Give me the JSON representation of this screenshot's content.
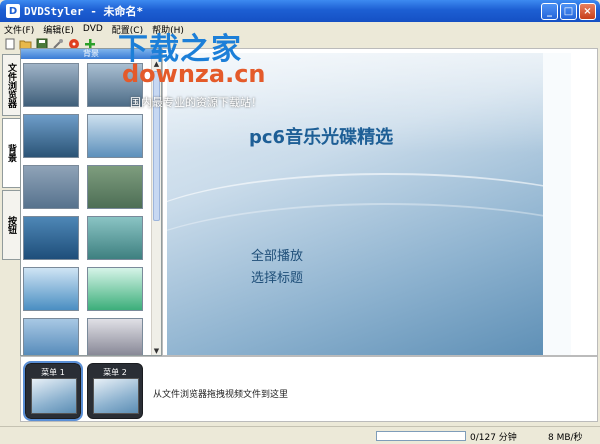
{
  "window": {
    "title": "DVDStyler - 未命名*",
    "buttons": {
      "minimize": "_",
      "maximize": "□",
      "close": "×"
    }
  },
  "menu": [
    "文件(F)",
    "编辑(E)",
    "DVD",
    "配置(C)",
    "帮助(H)"
  ],
  "toolbar": {
    "icons": [
      "new-icon",
      "open-icon",
      "save-icon",
      "settings-icon",
      "burn-icon",
      "add-icon"
    ]
  },
  "watermark": {
    "title": "下载之家",
    "url": "downza.cn",
    "subtitle": "国内最专业的资源下载站！"
  },
  "left_tabs": [
    "文件浏览器",
    "背景",
    "按钮"
  ],
  "panel": {
    "header": "背景",
    "thumbnails": [
      {
        "colors": [
          "#9fb3c7",
          "#3f5f7a"
        ]
      },
      {
        "colors": [
          "#a9bfd2",
          "#4d6c87"
        ]
      },
      {
        "colors": [
          "#6e9dc9",
          "#2b5476"
        ]
      },
      {
        "colors": [
          "#cde0ef",
          "#5d90bb"
        ]
      },
      {
        "colors": [
          "#8fa3b8",
          "#56728d"
        ]
      },
      {
        "colors": [
          "#7e9d7e",
          "#4d6e55"
        ]
      },
      {
        "colors": [
          "#4e87b6",
          "#1e4e7a"
        ]
      },
      {
        "colors": [
          "#8ac4c4",
          "#3e8080"
        ]
      },
      {
        "colors": [
          "#cfe4f4",
          "#4a8ec2"
        ]
      },
      {
        "colors": [
          "#d6f4e8",
          "#3cae7a"
        ]
      },
      {
        "colors": [
          "#a8c8e4",
          "#4a82b4"
        ]
      },
      {
        "colors": [
          "#e0e0e6",
          "#7a7a8a"
        ]
      }
    ]
  },
  "preview": {
    "title": "pc6音乐光碟精选",
    "play_all": "全部播放",
    "select_title": "选择标题"
  },
  "menus": {
    "items": [
      "菜单 1",
      "菜单 2"
    ],
    "hint": "从文件浏览器拖拽视频文件到这里"
  },
  "status": {
    "progress": 0,
    "size": "0/127 分钟",
    "rate": "8 MB/秒"
  }
}
